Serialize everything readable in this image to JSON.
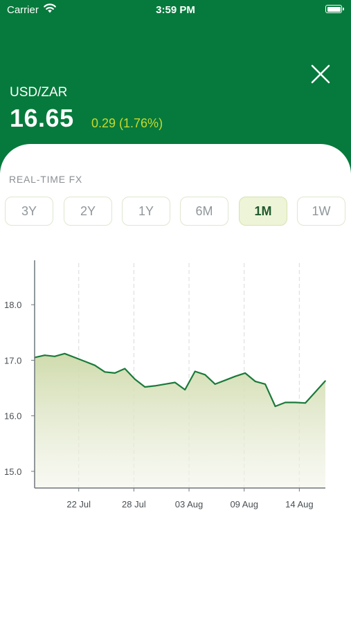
{
  "status_bar": {
    "carrier": "Carrier",
    "time": "3:59 PM"
  },
  "header": {
    "pair": "USD/ZAR",
    "rate": "16.65",
    "change": "0.29 (1.76%)"
  },
  "section_label": "REAL-TIME FX",
  "ranges": [
    {
      "label": "3Y",
      "active": false
    },
    {
      "label": "2Y",
      "active": false
    },
    {
      "label": "1Y",
      "active": false
    },
    {
      "label": "6M",
      "active": false
    },
    {
      "label": "1M",
      "active": true
    },
    {
      "label": "1W",
      "active": false
    }
  ],
  "colors": {
    "header_bg": "#067a3c",
    "line": "#1a7a3a",
    "change": "#c9d82e",
    "active_range_bg": "#eef4d8"
  },
  "icons": {
    "close": "close-icon",
    "wifi": "wifi-icon",
    "battery": "battery-icon"
  },
  "chart_data": {
    "type": "area",
    "ylim": [
      14.7,
      18.8
    ],
    "yticks": [
      15.0,
      16.0,
      17.0,
      18.0
    ],
    "ytick_labels": [
      "15.0",
      "16.0",
      "17.0",
      "18.0"
    ],
    "xlim": [
      0,
      29
    ],
    "xticks": [
      4.4,
      9.9,
      15.4,
      20.9,
      26.4
    ],
    "xtick_labels": [
      "22 Jul",
      "28 Jul",
      "03 Aug",
      "09 Aug",
      "14 Aug"
    ],
    "grid": "vertical dashed",
    "x": [
      0,
      1,
      2,
      3,
      4,
      5,
      6,
      7,
      8,
      9,
      10,
      11,
      12,
      13,
      14,
      15,
      16,
      17,
      18,
      19,
      20,
      21,
      22,
      23,
      24,
      25,
      26,
      27,
      28,
      29
    ],
    "values": [
      17.05,
      17.09,
      17.07,
      17.12,
      17.05,
      16.98,
      16.91,
      16.79,
      16.77,
      16.85,
      16.66,
      16.52,
      16.54,
      16.57,
      16.6,
      16.47,
      16.8,
      16.74,
      16.57,
      16.64,
      16.71,
      16.77,
      16.62,
      16.57,
      16.17,
      16.24,
      16.24,
      16.23,
      16.43,
      16.63
    ]
  }
}
